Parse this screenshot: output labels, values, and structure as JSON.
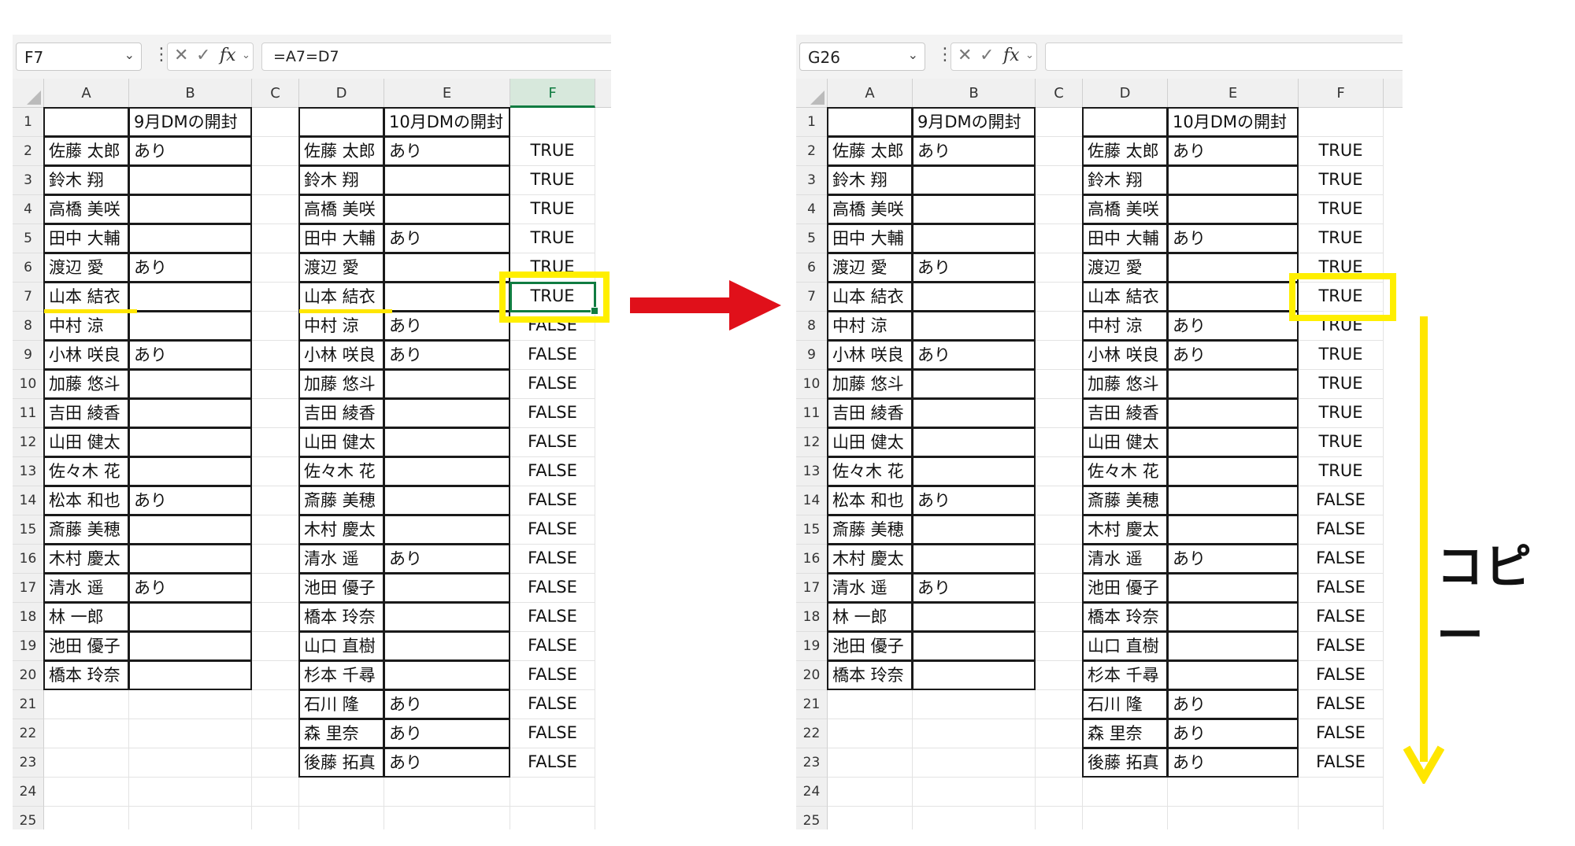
{
  "left_sheet": {
    "name_box": "F7",
    "formula": "=A7=D7",
    "columns": [
      "A",
      "B",
      "C",
      "D",
      "E",
      "F"
    ],
    "rows": [
      "1",
      "2",
      "3",
      "4",
      "5",
      "6",
      "7",
      "8",
      "9",
      "10",
      "11",
      "12",
      "13",
      "14",
      "15",
      "16",
      "17",
      "18",
      "19",
      "20",
      "21",
      "22",
      "23",
      "24",
      "25"
    ],
    "header_b": "9月DMの開封",
    "header_e": "10月DMの開封",
    "col_a": [
      "佐藤 太郎",
      "鈴木 翔",
      "高橋 美咲",
      "田中 大輔",
      "渡辺 愛",
      "山本 結衣",
      "中村 涼",
      "小林 咲良",
      "加藤 悠斗",
      "吉田 綾香",
      "山田 健太",
      "佐々木 花",
      "松本 和也",
      "斎藤 美穂",
      "木村 慶太",
      "清水 遥",
      "林 一郎",
      "池田 優子",
      "橋本 玲奈"
    ],
    "col_b": [
      "あり",
      "",
      "",
      "",
      "あり",
      "",
      "",
      "あり",
      "",
      "",
      "",
      "",
      "あり",
      "",
      "",
      "あり",
      "",
      "",
      ""
    ],
    "col_d": [
      "佐藤 太郎",
      "鈴木 翔",
      "高橋 美咲",
      "田中 大輔",
      "渡辺 愛",
      "山本 結衣",
      "中村 涼",
      "小林 咲良",
      "加藤 悠斗",
      "吉田 綾香",
      "山田 健太",
      "佐々木 花",
      "斎藤 美穂",
      "木村 慶太",
      "清水 遥",
      "池田 優子",
      "橋本 玲奈",
      "山口 直樹",
      "杉本 千尋",
      "石川 隆",
      "森 里奈",
      "後藤 拓真"
    ],
    "col_e": [
      "あり",
      "",
      "",
      "あり",
      "",
      "",
      "あり",
      "あり",
      "",
      "",
      "",
      "",
      "",
      "",
      "あり",
      "",
      "",
      "",
      "",
      "あり",
      "あり",
      "あり"
    ],
    "col_f": [
      "TRUE",
      "TRUE",
      "TRUE",
      "TRUE",
      "TRUE",
      "TRUE",
      "FALSE",
      "FALSE",
      "FALSE",
      "FALSE",
      "FALSE",
      "FALSE",
      "FALSE",
      "FALSE",
      "FALSE",
      "FALSE",
      "FALSE",
      "FALSE",
      "FALSE",
      "FALSE",
      "FALSE",
      "FALSE"
    ]
  },
  "right_sheet": {
    "name_box": "G26",
    "formula": "",
    "columns": [
      "A",
      "B",
      "C",
      "D",
      "E",
      "F"
    ],
    "rows": [
      "1",
      "2",
      "3",
      "4",
      "5",
      "6",
      "7",
      "8",
      "9",
      "10",
      "11",
      "12",
      "13",
      "14",
      "15",
      "16",
      "17",
      "18",
      "19",
      "20",
      "21",
      "22",
      "23",
      "24",
      "25"
    ],
    "header_b": "9月DMの開封",
    "header_e": "10月DMの開封",
    "col_a": [
      "佐藤 太郎",
      "鈴木 翔",
      "高橋 美咲",
      "田中 大輔",
      "渡辺 愛",
      "山本 結衣",
      "中村 涼",
      "小林 咲良",
      "加藤 悠斗",
      "吉田 綾香",
      "山田 健太",
      "佐々木 花",
      "松本 和也",
      "斎藤 美穂",
      "木村 慶太",
      "清水 遥",
      "林 一郎",
      "池田 優子",
      "橋本 玲奈"
    ],
    "col_b": [
      "あり",
      "",
      "",
      "",
      "あり",
      "",
      "",
      "あり",
      "",
      "",
      "",
      "",
      "あり",
      "",
      "",
      "あり",
      "",
      "",
      ""
    ],
    "col_d": [
      "佐藤 太郎",
      "鈴木 翔",
      "高橋 美咲",
      "田中 大輔",
      "渡辺 愛",
      "山本 結衣",
      "中村 涼",
      "小林 咲良",
      "加藤 悠斗",
      "吉田 綾香",
      "山田 健太",
      "佐々木 花",
      "斎藤 美穂",
      "木村 慶太",
      "清水 遥",
      "池田 優子",
      "橋本 玲奈",
      "山口 直樹",
      "杉本 千尋",
      "石川 隆",
      "森 里奈",
      "後藤 拓真"
    ],
    "col_e": [
      "あり",
      "",
      "",
      "あり",
      "",
      "",
      "あり",
      "あり",
      "",
      "",
      "",
      "",
      "",
      "",
      "あり",
      "",
      "",
      "",
      "",
      "あり",
      "あり",
      "あり"
    ],
    "col_f": [
      "TRUE",
      "TRUE",
      "TRUE",
      "TRUE",
      "TRUE",
      "TRUE",
      "TRUE",
      "TRUE",
      "TRUE",
      "TRUE",
      "TRUE",
      "TRUE",
      "FALSE",
      "FALSE",
      "FALSE",
      "FALSE",
      "FALSE",
      "FALSE",
      "FALSE",
      "FALSE",
      "FALSE",
      "FALSE"
    ]
  },
  "annotation": {
    "copy_label": "コピー",
    "highlight_color": "#ffef00",
    "arrow_color": "#e0101a",
    "selection_color": "#107c41"
  }
}
